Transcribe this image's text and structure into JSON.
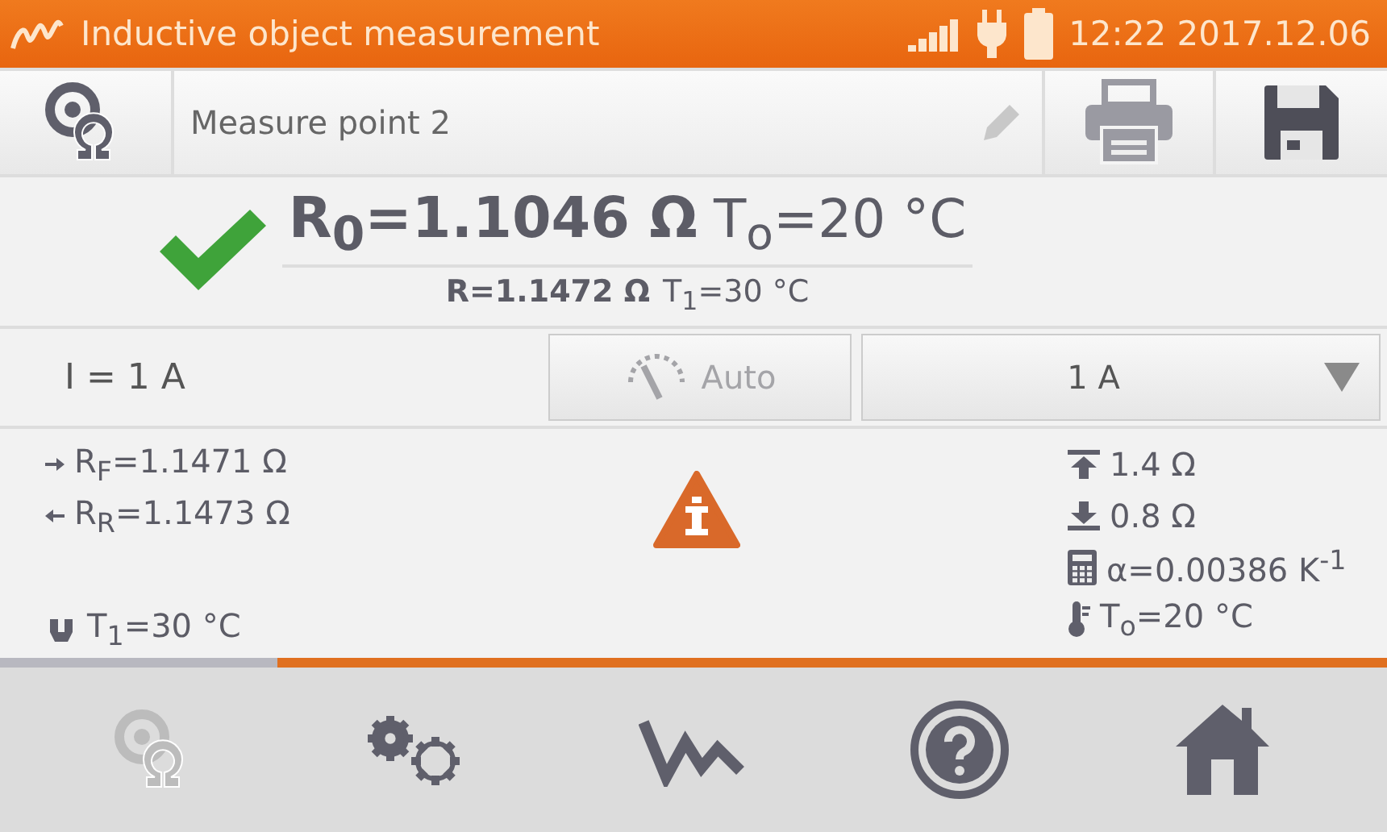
{
  "header": {
    "title": "Inductive object measurement",
    "time": "12:22 2017.12.06"
  },
  "toolbar": {
    "name": "Measure point 2"
  },
  "result": {
    "passed": true,
    "main_value": "R$_{0}$=1.1046 Ω",
    "main_temp": "T$_{o}$=20 °C",
    "secondary_value": "R=1.1472 Ω",
    "secondary_temp": "T$_{1}$=30 °C"
  },
  "current": {
    "label": "I = 1 A",
    "auto": {
      "label": "Auto",
      "disabled": true
    },
    "range": "1 A"
  },
  "details_left": [
    {
      "kind": "forward",
      "text": "R$_{F}$=1.1471 Ω"
    },
    {
      "kind": "reverse",
      "text": "R$_{R}$=1.1473 Ω"
    }
  ],
  "probe_temperature": "T$_{1}$=30 °C",
  "details_right": [
    {
      "kind": "upper",
      "text": "1.4 Ω"
    },
    {
      "kind": "lower",
      "text": "0.8 Ω"
    },
    {
      "kind": "coefficient",
      "text": "α=0.00386 K$^{-1}$"
    },
    {
      "kind": "reference",
      "text": "T$_{o}$=20 °C"
    }
  ],
  "nav": [
    {
      "kind": "measure",
      "disabled": true
    },
    {
      "kind": "settings",
      "disabled": false
    },
    {
      "kind": "graph",
      "disabled": false
    },
    {
      "kind": "help",
      "disabled": false
    },
    {
      "kind": "home",
      "disabled": false
    }
  ]
}
